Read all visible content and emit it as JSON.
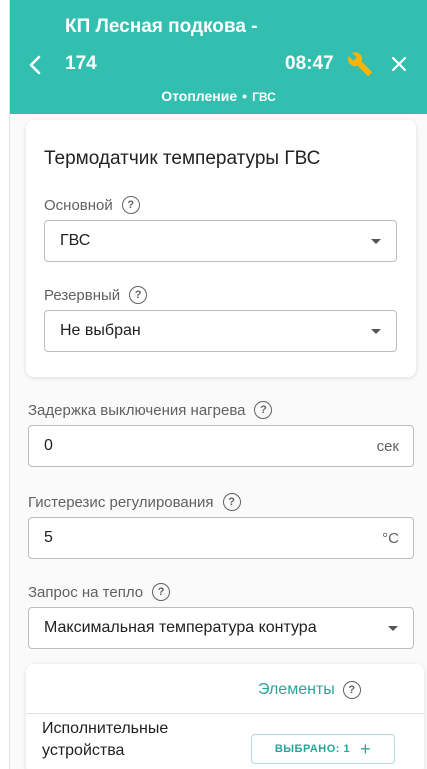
{
  "header": {
    "title_line1": "КП Лесная подкова   -",
    "title_line2": "174",
    "time": "08:47",
    "breadcrumb": {
      "parent": "Отопление",
      "separator": "•",
      "current": "ГВС"
    },
    "back_icon": "chevron-left-icon",
    "wrench_icon": "wrench-icon",
    "close_icon": "close-icon",
    "bg_color": "#33bfb0",
    "wrench_color": "#ffb300"
  },
  "sensor_card": {
    "heading": "Термодатчик температуры ГВС",
    "primary": {
      "label": "Основной",
      "value": "ГВС"
    },
    "backup": {
      "label": "Резервный",
      "value": "Не выбран"
    }
  },
  "heating_delay": {
    "label": "Задержка выключения нагрева",
    "value": "0",
    "unit": "сек"
  },
  "hysteresis": {
    "label": "Гистерезис регулирования",
    "value": "5",
    "unit": "°C"
  },
  "heat_request": {
    "label": "Запрос на тепло",
    "value": "Максимальная температура контура"
  },
  "elements_card": {
    "elements_link": "Элементы",
    "devices_label": "Исполнительные устройства",
    "selected_chip": "ВЫБРАНО: 1",
    "add_symbol": "+",
    "accent_color": "#26a69a"
  },
  "help_symbol": "?"
}
